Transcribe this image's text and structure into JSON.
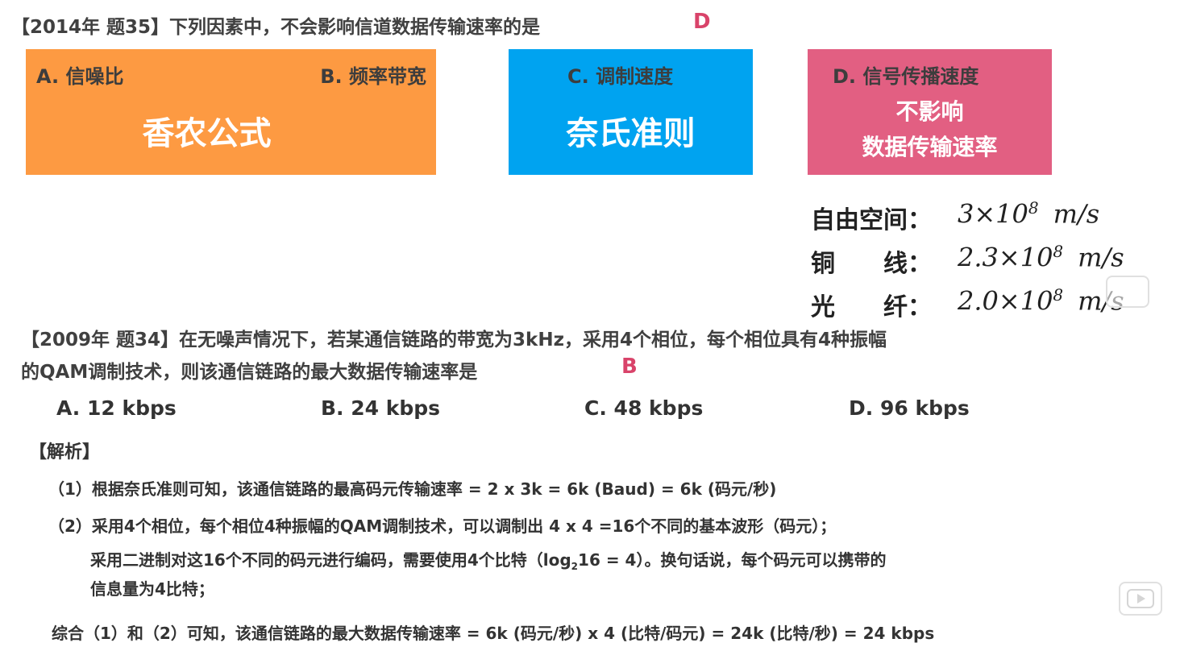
{
  "q1": {
    "title": "【2014年 题35】下列因素中，不会影响信道数据传输速率的是",
    "answer": "D",
    "boxes": {
      "ab": {
        "a_label": "A. 信噪比",
        "b_label": "B. 频率带宽",
        "main": "香农公式",
        "color": "#fd9a42"
      },
      "c": {
        "label": "C. 调制速度",
        "main": "奈氏准则",
        "color": "#00a3f0"
      },
      "d": {
        "label": "D. 信号传播速度",
        "line1": "不影响",
        "line2": "数据传输速率",
        "color": "#e25f82"
      }
    },
    "speeds": [
      {
        "name": "自由空间：",
        "coef": "3×10",
        "exp": "8",
        "unit": "m/s"
      },
      {
        "name": "铜　　线：",
        "coef": "2.3×10",
        "exp": "8",
        "unit": "m/s"
      },
      {
        "name": "光　　纤：",
        "coef": "2.0×10",
        "exp": "8",
        "unit": "m/s"
      }
    ]
  },
  "q2": {
    "title_line1": "【2009年 题34】在无噪声情况下，若某通信链路的带宽为3kHz，采用4个相位，每个相位具有4种振幅",
    "title_line2": "的QAM调制技术，则该通信链路的最大数据传输速率是",
    "answer": "B",
    "options": [
      "A. 12 kbps",
      "B. 24 kbps",
      "C. 48 kbps",
      "D. 96 kbps"
    ],
    "analysis_label": "【解析】",
    "step1": "（1）根据奈氏准则可知，该通信链路的最高码元传输速率 = 2 x 3k = 6k (Baud) = 6k (码元/秒)",
    "step2_line1": "（2）采用4个相位，每个相位4种振幅的QAM调制技术，可以调制出 4 x 4 =16个不同的基本波形（码元）；",
    "step2_line2a": "采用二进制对这16个不同的码元进行编码，需要使用4个比特（log",
    "step2_sub": "2",
    "step2_line2b": "16 = 4）。换句话说，每个码元可以携带的",
    "step2_line3": "信息量为4比特；",
    "conclusion": "综合（1）和（2）可知，该通信链路的最大数据传输速率 = 6k (码元/秒) x 4 (比特/码元) = 24k (比特/秒) = 24 kbps"
  }
}
